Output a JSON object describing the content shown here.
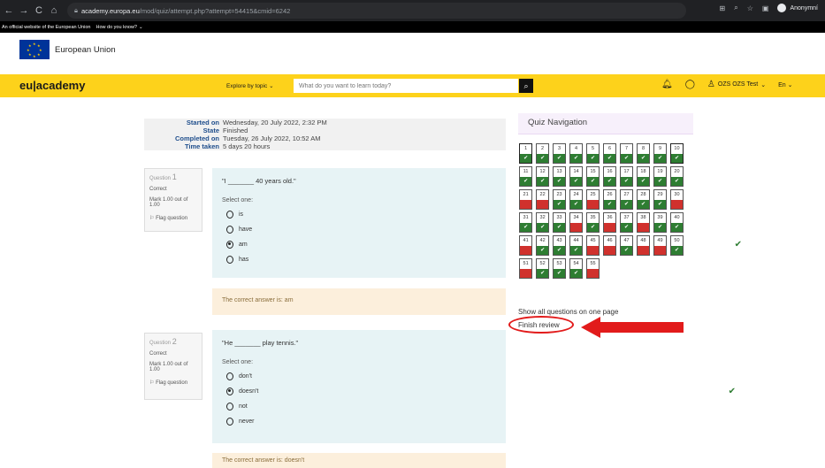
{
  "browser": {
    "url_domain": "academy.europa.eu",
    "url_path": "/mod/quiz/attempt.php?attempt=54415&cmid=6242",
    "profile_label": "Anonymní"
  },
  "eu_banner": {
    "text": "An official website of the European Union",
    "link": "How do you know?"
  },
  "eu_header": {
    "name": "European Union"
  },
  "nav": {
    "brand": "eu|academy",
    "explore_label": "Explore by topic",
    "search_placeholder": "What do you want to learn today?",
    "user_name": "OZS OZS Test",
    "language": "En"
  },
  "summary": [
    {
      "label": "Started on",
      "value": "Wednesday, 20 July 2022, 2:32 PM"
    },
    {
      "label": "State",
      "value": "Finished"
    },
    {
      "label": "Completed on",
      "value": "Tuesday, 26 July 2022, 10:52 AM"
    },
    {
      "label": "Time taken",
      "value": "5 days 20 hours"
    }
  ],
  "questions": [
    {
      "title": "Question",
      "number": "1",
      "status": "Correct",
      "mark": "Mark 1.00 out of 1.00",
      "flag": "Flag question",
      "text": "\"I _______ 40 years old.\"",
      "select_one": "Select one:",
      "options": [
        "is",
        "have",
        "am",
        "has"
      ],
      "selected": 2,
      "feedback": "The correct answer is: am"
    },
    {
      "title": "Question",
      "number": "2",
      "status": "Correct",
      "mark": "Mark 1.00 out of 1.00",
      "flag": "Flag question",
      "text": "\"He _______ play tennis.\"",
      "select_one": "Select one:",
      "options": [
        "don't",
        "doesn't",
        "not",
        "never"
      ],
      "selected": 1,
      "feedback": "The correct answer is: doesn't"
    }
  ],
  "quiz_nav": {
    "title": "Quiz Navigation",
    "items": [
      {
        "n": "1",
        "s": "correct"
      },
      {
        "n": "2",
        "s": "correct"
      },
      {
        "n": "3",
        "s": "correct"
      },
      {
        "n": "4",
        "s": "correct"
      },
      {
        "n": "5",
        "s": "correct"
      },
      {
        "n": "6",
        "s": "correct"
      },
      {
        "n": "7",
        "s": "correct"
      },
      {
        "n": "8",
        "s": "correct"
      },
      {
        "n": "9",
        "s": "correct"
      },
      {
        "n": "10",
        "s": "correct"
      },
      {
        "n": "11",
        "s": "correct"
      },
      {
        "n": "12",
        "s": "correct"
      },
      {
        "n": "13",
        "s": "correct"
      },
      {
        "n": "14",
        "s": "correct"
      },
      {
        "n": "15",
        "s": "correct"
      },
      {
        "n": "16",
        "s": "correct"
      },
      {
        "n": "17",
        "s": "correct"
      },
      {
        "n": "18",
        "s": "correct"
      },
      {
        "n": "19",
        "s": "correct"
      },
      {
        "n": "20",
        "s": "correct"
      },
      {
        "n": "21",
        "s": "wrong"
      },
      {
        "n": "22",
        "s": "wrong"
      },
      {
        "n": "23",
        "s": "correct"
      },
      {
        "n": "24",
        "s": "correct"
      },
      {
        "n": "25",
        "s": "wrong"
      },
      {
        "n": "26",
        "s": "correct"
      },
      {
        "n": "27",
        "s": "correct"
      },
      {
        "n": "28",
        "s": "correct"
      },
      {
        "n": "29",
        "s": "correct"
      },
      {
        "n": "30",
        "s": "wrong"
      },
      {
        "n": "31",
        "s": "correct"
      },
      {
        "n": "32",
        "s": "correct"
      },
      {
        "n": "33",
        "s": "correct"
      },
      {
        "n": "34",
        "s": "wrong"
      },
      {
        "n": "35",
        "s": "correct"
      },
      {
        "n": "36",
        "s": "wrong"
      },
      {
        "n": "37",
        "s": "correct"
      },
      {
        "n": "38",
        "s": "wrong"
      },
      {
        "n": "39",
        "s": "correct"
      },
      {
        "n": "40",
        "s": "correct"
      },
      {
        "n": "41",
        "s": "wrong"
      },
      {
        "n": "42",
        "s": "correct"
      },
      {
        "n": "43",
        "s": "correct"
      },
      {
        "n": "44",
        "s": "correct"
      },
      {
        "n": "45",
        "s": "wrong"
      },
      {
        "n": "46",
        "s": "wrong"
      },
      {
        "n": "47",
        "s": "correct"
      },
      {
        "n": "48",
        "s": "wrong"
      },
      {
        "n": "49",
        "s": "wrong"
      },
      {
        "n": "50",
        "s": "correct"
      },
      {
        "n": "51",
        "s": "wrong"
      },
      {
        "n": "52",
        "s": "correct"
      },
      {
        "n": "53",
        "s": "correct"
      },
      {
        "n": "54",
        "s": "correct"
      },
      {
        "n": "55",
        "s": "wrong"
      }
    ],
    "show_all": "Show all questions on one page",
    "finish_review": "Finish review"
  },
  "colors": {
    "nav_yellow": "#fdd21b",
    "correct": "#2e7d32",
    "wrong": "#d0312d",
    "annotation_red": "#e21b1b"
  }
}
